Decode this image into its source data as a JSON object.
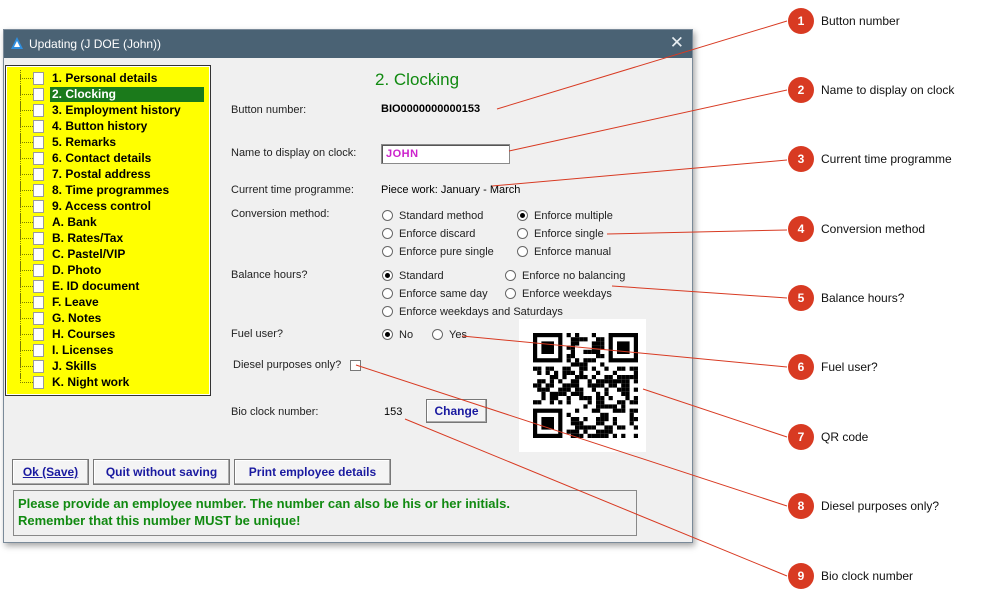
{
  "window": {
    "title": "Updating  (J DOE (John))",
    "close_glyph": "✕"
  },
  "tree": [
    {
      "label": "1. Personal details",
      "selected": false
    },
    {
      "label": "2. Clocking",
      "selected": true
    },
    {
      "label": "3. Employment history",
      "selected": false
    },
    {
      "label": "4. Button history",
      "selected": false
    },
    {
      "label": "5. Remarks",
      "selected": false
    },
    {
      "label": "6. Contact details",
      "selected": false
    },
    {
      "label": "7. Postal address",
      "selected": false
    },
    {
      "label": "8. Time programmes",
      "selected": false
    },
    {
      "label": "9. Access control",
      "selected": false
    },
    {
      "label": "A. Bank",
      "selected": false
    },
    {
      "label": "B. Rates/Tax",
      "selected": false
    },
    {
      "label": "C. Pastel/VIP",
      "selected": false
    },
    {
      "label": "D. Photo",
      "selected": false
    },
    {
      "label": "E. ID document",
      "selected": false
    },
    {
      "label": "F. Leave",
      "selected": false
    },
    {
      "label": "G. Notes",
      "selected": false
    },
    {
      "label": "H. Courses",
      "selected": false
    },
    {
      "label": "I. Licenses",
      "selected": false
    },
    {
      "label": "J. Skills",
      "selected": false
    },
    {
      "label": "K. Night work",
      "selected": false
    }
  ],
  "form": {
    "heading": "2. Clocking",
    "button_number_label": "Button number:",
    "button_number_value": "BIO0000000000153",
    "name_label": "Name to display on clock:",
    "name_value": "JOHN",
    "time_programme_label": "Current time programme:",
    "time_programme_value": "Piece work: January - March",
    "conversion_label": "Conversion method:",
    "conversion_options": [
      {
        "label": "Standard method",
        "checked": false
      },
      {
        "label": "Enforce multiple",
        "checked": true
      },
      {
        "label": "Enforce discard",
        "checked": false
      },
      {
        "label": "Enforce single",
        "checked": false
      },
      {
        "label": "Enforce pure single",
        "checked": false
      },
      {
        "label": "Enforce manual",
        "checked": false
      }
    ],
    "balance_label": "Balance hours?",
    "balance_options": [
      {
        "label": "Standard",
        "checked": true
      },
      {
        "label": "Enforce no balancing",
        "checked": false
      },
      {
        "label": "Enforce same day",
        "checked": false
      },
      {
        "label": "Enforce weekdays",
        "checked": false
      },
      {
        "label": "Enforce weekdays and Saturdays",
        "checked": false
      }
    ],
    "fuel_label": "Fuel user?",
    "fuel_options": [
      {
        "label": "No",
        "checked": true
      },
      {
        "label": "Yes",
        "checked": false
      }
    ],
    "diesel_label": "Diesel purposes only?",
    "diesel_checked": false,
    "bio_label": "Bio clock number:",
    "bio_value": "153",
    "change_button": "Change"
  },
  "buttons": {
    "ok": "Ok (Save)",
    "quit": "Quit without saving",
    "print": "Print employee details"
  },
  "message": {
    "line1": "Please provide an employee number. The number can also be his or her initials.",
    "line2": "Remember that this number MUST be unique!"
  },
  "callouts": [
    {
      "number": "1",
      "text": "Button number"
    },
    {
      "number": "2",
      "text": "Name to display on clock"
    },
    {
      "number": "3",
      "text": "Current time programme"
    },
    {
      "number": "4",
      "text": "Conversion method"
    },
    {
      "number": "5",
      "text": "Balance hours?"
    },
    {
      "number": "6",
      "text": "Fuel user?"
    },
    {
      "number": "7",
      "text": "QR code"
    },
    {
      "number": "8",
      "text": "Diesel purposes only?"
    },
    {
      "number": "9",
      "text": "Bio clock number"
    }
  ],
  "colors": {
    "titlebar": "#4a6274",
    "tree_background": "#ffff00",
    "tree_selection": "#1b7a1b",
    "heading": "#118a11",
    "name_value": "#cc22cc",
    "button_text": "#1a1aa0",
    "message_text": "#118a11",
    "callout": "#d83a22"
  }
}
